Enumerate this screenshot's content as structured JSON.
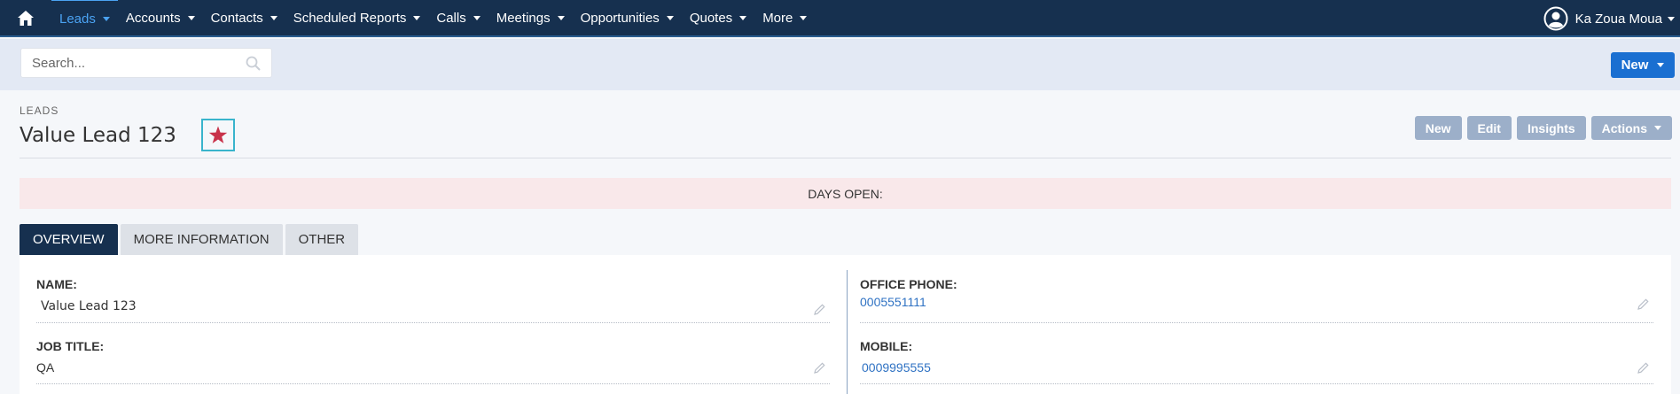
{
  "navbar": {
    "items": [
      {
        "label": "Leads",
        "active": true
      },
      {
        "label": "Accounts",
        "active": false
      },
      {
        "label": "Contacts",
        "active": false
      },
      {
        "label": "Scheduled Reports",
        "active": false
      },
      {
        "label": "Calls",
        "active": false
      },
      {
        "label": "Meetings",
        "active": false
      },
      {
        "label": "Opportunities",
        "active": false
      },
      {
        "label": "Quotes",
        "active": false
      },
      {
        "label": "More",
        "active": false
      }
    ],
    "user_name": "Ka Zoua Moua"
  },
  "search": {
    "placeholder": "Search...",
    "new_button": "New"
  },
  "header": {
    "module": "LEADS",
    "title": "Value Lead 123",
    "favorite_icon": "star-icon",
    "buttons": {
      "new": "New",
      "edit": "Edit",
      "insights": "Insights",
      "actions": "Actions"
    }
  },
  "banner": {
    "days_open": "DAYS OPEN:"
  },
  "tabs": [
    {
      "label": "OVERVIEW",
      "active": true
    },
    {
      "label": "MORE INFORMATION",
      "active": false
    },
    {
      "label": "OTHER",
      "active": false
    }
  ],
  "fields": {
    "name": {
      "label": "NAME:",
      "value": "Value Lead 123"
    },
    "job_title": {
      "label": "JOB TITLE:",
      "value": "QA"
    },
    "office_phone": {
      "label": "OFFICE PHONE:",
      "value": "0005551111"
    },
    "mobile": {
      "label": "MOBILE:",
      "value": "0009995555"
    }
  },
  "colors": {
    "navbar_bg": "#16304f",
    "active_nav": "#4ba3f3",
    "primary_button": "#1a6fd1",
    "secondary_button": "#9cafc9",
    "favorite_star": "#c8324a",
    "favorite_border": "#39b4cc",
    "banner_bg": "#f9e8ea",
    "link": "#2f72c3"
  }
}
